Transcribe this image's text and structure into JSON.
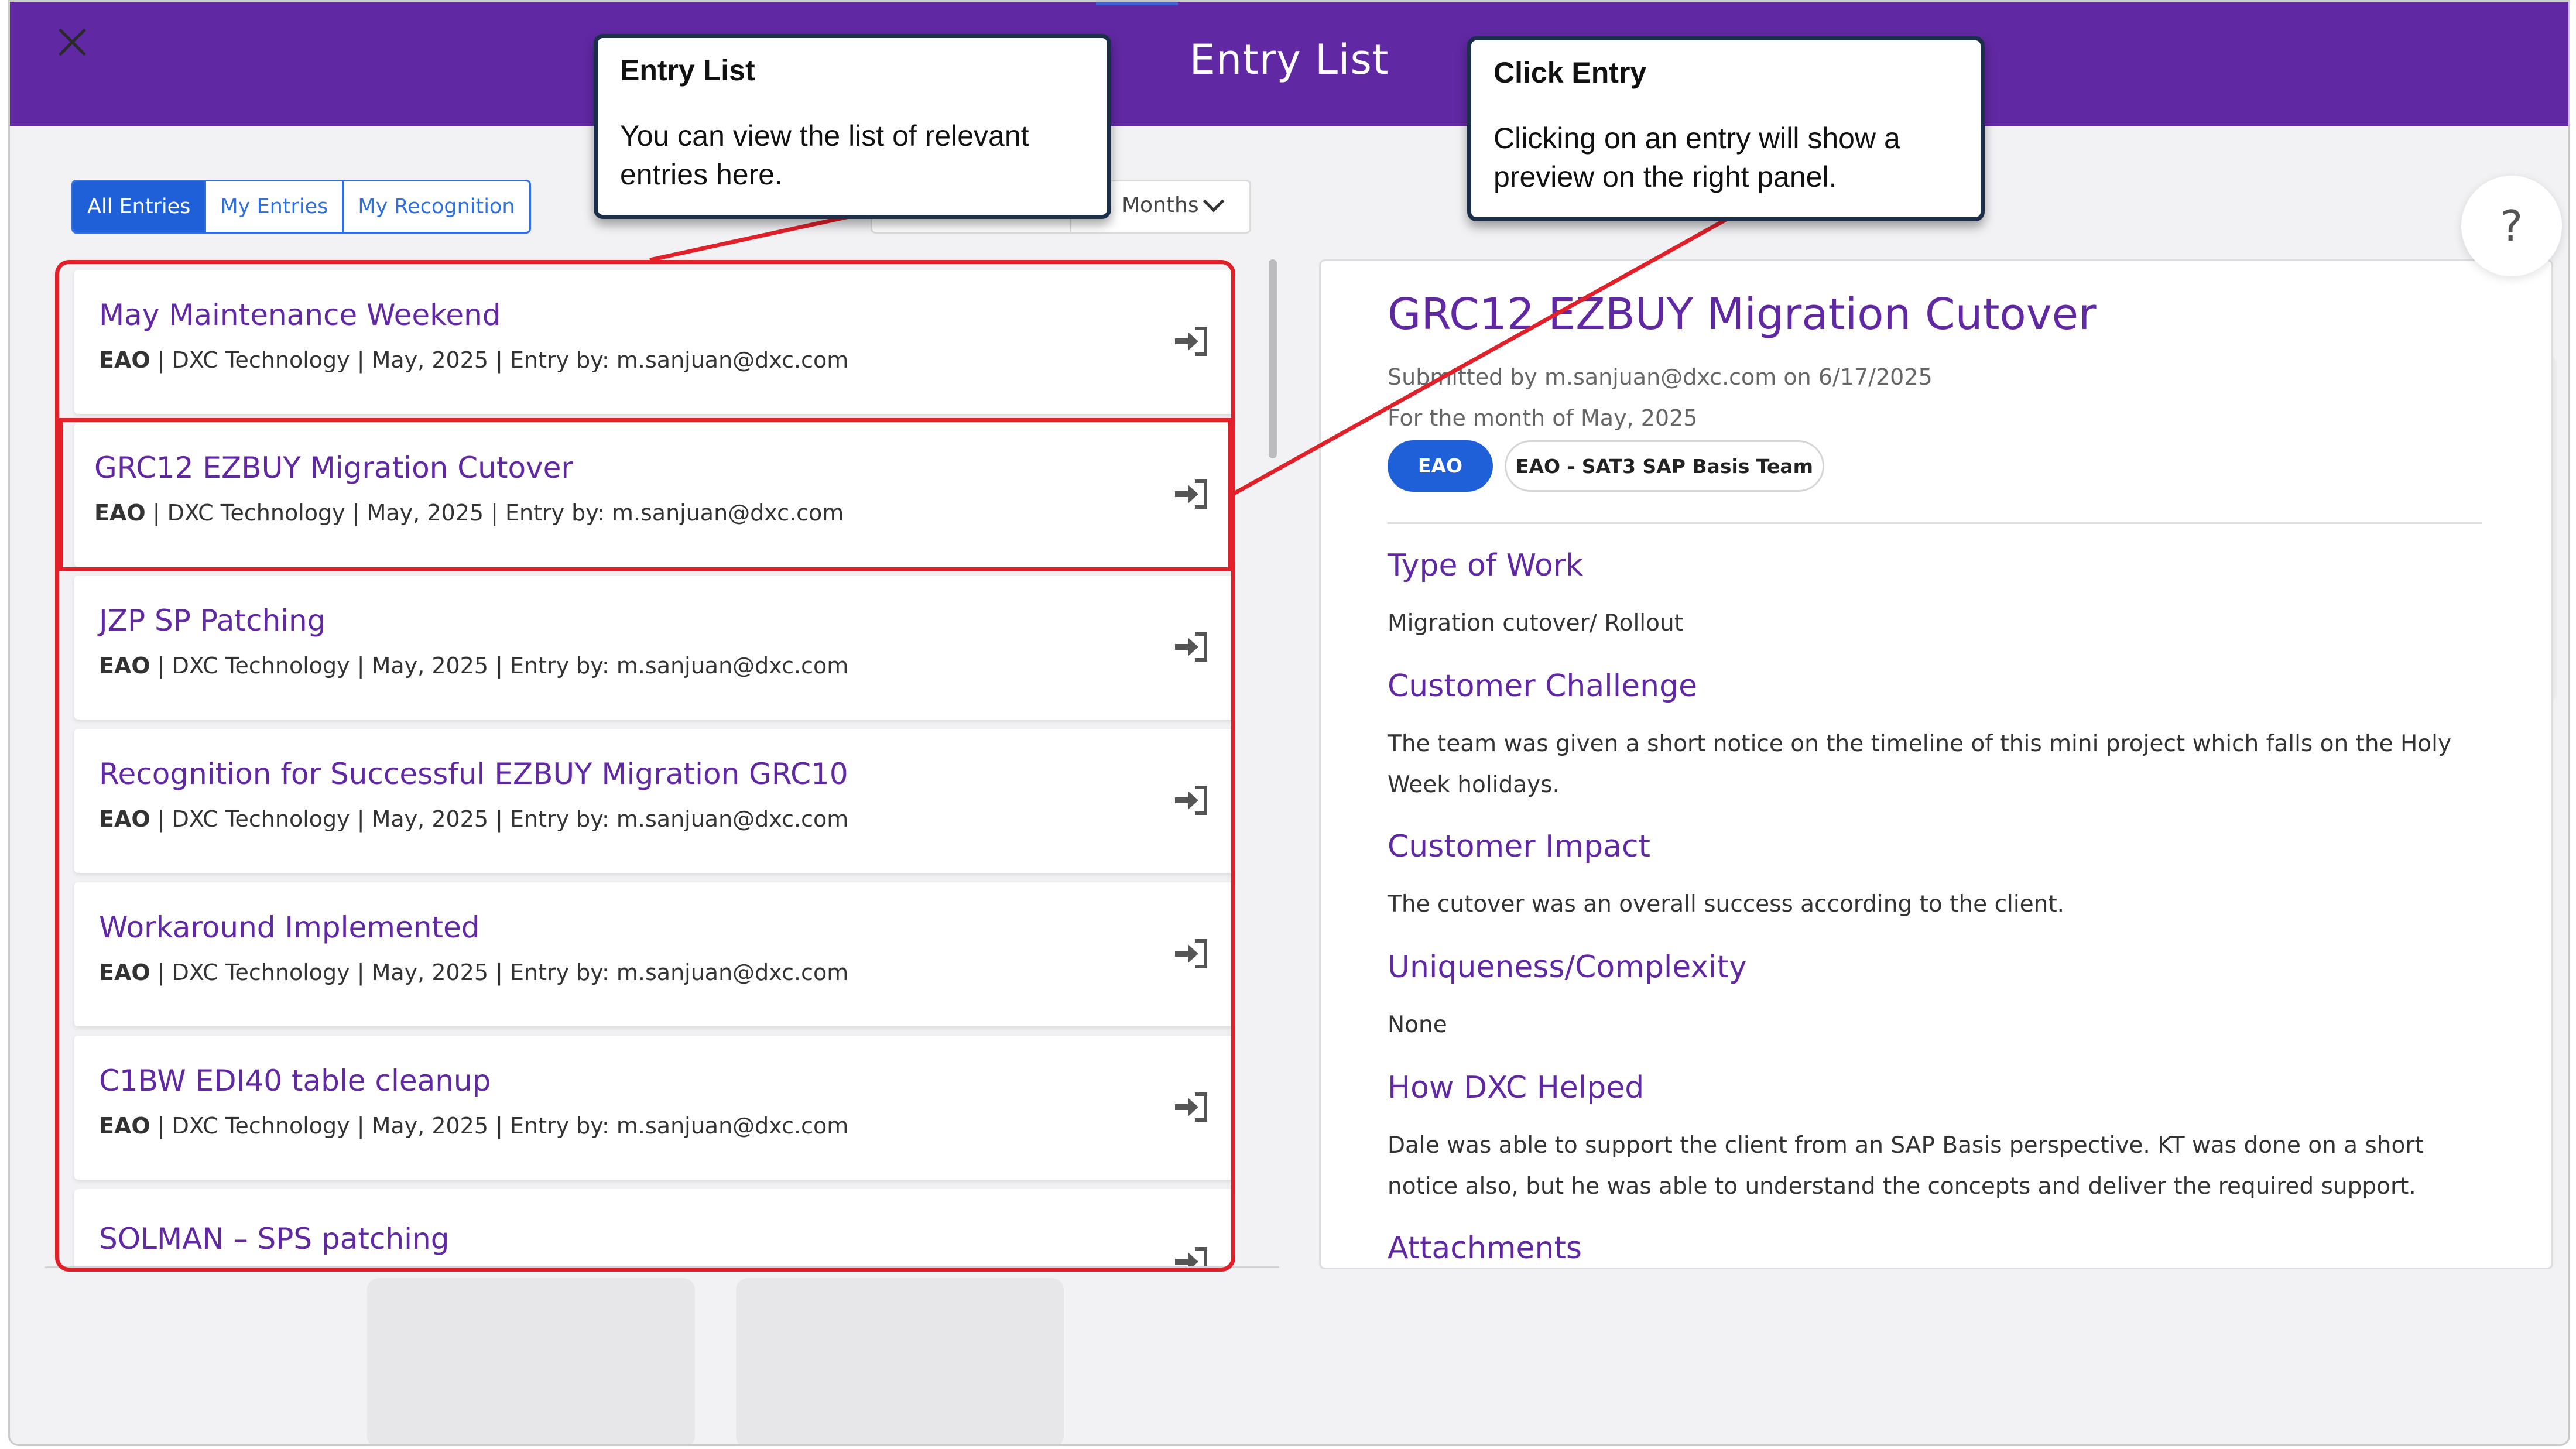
{
  "header": {
    "title": "Entry List",
    "close_icon": "close-icon"
  },
  "tabs": [
    {
      "label": "All Entries",
      "active": true
    },
    {
      "label": "My Entries",
      "active": false
    },
    {
      "label": "My Recognition",
      "active": false
    }
  ],
  "filter": {
    "selected": "Months"
  },
  "entries": [
    {
      "title": "May Maintenance Weekend",
      "org": "EAO",
      "meta": " | DXC Technology | May, 2025 | Entry by: m.sanjuan@dxc.com"
    },
    {
      "title": "GRC12 EZBUY Migration Cutover",
      "org": "EAO",
      "meta": " | DXC Technology | May, 2025 | Entry by: m.sanjuan@dxc.com"
    },
    {
      "title": "JZP SP Patching",
      "org": "EAO",
      "meta": " | DXC Technology | May, 2025 | Entry by: m.sanjuan@dxc.com"
    },
    {
      "title": "Recognition for Successful EZBUY Migration GRC10",
      "org": "EAO",
      "meta": " | DXC Technology | May, 2025 | Entry by: m.sanjuan@dxc.com"
    },
    {
      "title": "Workaround Implemented",
      "org": "EAO",
      "meta": " | DXC Technology | May, 2025 | Entry by: m.sanjuan@dxc.com"
    },
    {
      "title": "C1BW EDI40 table cleanup",
      "org": "EAO",
      "meta": " | DXC Technology | May, 2025 | Entry by: m.sanjuan@dxc.com"
    },
    {
      "title": "SOLMAN – SPS patching",
      "org": "",
      "meta": ""
    }
  ],
  "preview": {
    "title": "GRC12 EZBUY Migration Cutover",
    "submitted": "Submitted by m.sanjuan@dxc.com on 6/17/2025",
    "month": "For the month of May, 2025",
    "tags": [
      "EAO",
      "EAO - SAT3 SAP Basis Team"
    ],
    "sections": [
      {
        "heading": "Type of Work",
        "text": "Migration cutover/ Rollout"
      },
      {
        "heading": "Customer Challenge",
        "text": "The team was given a short notice on the timeline of this mini project which falls on the Holy Week holidays."
      },
      {
        "heading": "Customer Impact",
        "text": "The cutover was an overall success according to the client."
      },
      {
        "heading": "Uniqueness/Complexity",
        "text": "None"
      },
      {
        "heading": "How DXC Helped",
        "text": "Dale was able to support the client from an SAP Basis perspective. KT was done on a short notice also, but he was able to understand the concepts and deliver the required support."
      },
      {
        "heading": "Attachments",
        "text": ""
      }
    ]
  },
  "help": {
    "label": "?"
  },
  "callouts": [
    {
      "title": "Entry List",
      "body": "You can view the list of relevant entries here."
    },
    {
      "title": "Click Entry",
      "body": "Clicking on an entry will show a preview on the right panel."
    }
  ],
  "colors": {
    "header": "#6128a3",
    "accent_blue": "#1f5fd8",
    "highlight_red": "#e1202a",
    "title_purple": "#6128a3"
  }
}
